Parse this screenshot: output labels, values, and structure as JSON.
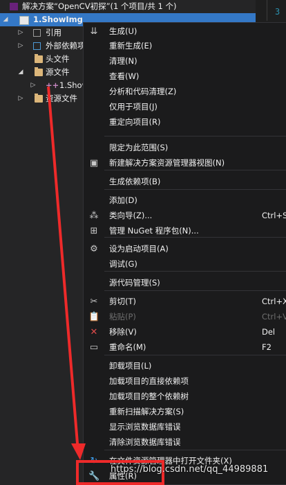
{
  "explorer": {
    "solution_label": "解决方案“OpenCV初探”(1 个项目/共 1 个)",
    "project_label": "1.ShowImg",
    "items": [
      {
        "label": "引用"
      },
      {
        "label": "外部依赖项"
      },
      {
        "label": "头文件"
      },
      {
        "label": "源文件"
      },
      {
        "label": "1.ShowImg"
      },
      {
        "label": "资源文件"
      }
    ]
  },
  "editor": {
    "line_number": "3"
  },
  "menu": {
    "items": [
      {
        "label": "生成(U)",
        "icon": "build-icon",
        "glyph": "⇊"
      },
      {
        "label": "重新生成(E)"
      },
      {
        "label": "清理(N)"
      },
      {
        "label": "查看(W)"
      },
      {
        "label": "分析和代码清理(Z)"
      },
      {
        "label": "仅用于项目(J)"
      },
      {
        "label": "重定向项目(R)"
      },
      {
        "label": "限定为此范围(S)"
      },
      {
        "label": "新建解决方案资源管理器视图(N)",
        "icon": "new-view-icon",
        "glyph": "▣"
      },
      {
        "label": "生成依赖项(B)"
      },
      {
        "label": "添加(D)"
      },
      {
        "label": "类向导(Z)...",
        "shortcut": "Ctrl+S",
        "icon": "class-wizard-icon",
        "glyph": "⁂"
      },
      {
        "label": "管理 NuGet 程序包(N)...",
        "icon": "nuget-icon",
        "glyph": "⊞"
      },
      {
        "label": "设为启动项目(A)",
        "icon": "gear-icon",
        "glyph": "⚙"
      },
      {
        "label": "调试(G)"
      },
      {
        "label": "源代码管理(S)"
      },
      {
        "label": "剪切(T)",
        "shortcut": "Ctrl+X",
        "icon": "scissors-icon",
        "glyph": "✂"
      },
      {
        "label": "粘贴(P)",
        "shortcut": "Ctrl+V",
        "icon": "paste-icon",
        "glyph": "📋",
        "disabled": true
      },
      {
        "label": "移除(V)",
        "shortcut": "Del",
        "icon": "remove-icon",
        "glyph": "✕"
      },
      {
        "label": "重命名(M)",
        "shortcut": "F2",
        "icon": "rename-icon",
        "glyph": "▭"
      },
      {
        "label": "卸载项目(L)"
      },
      {
        "label": "加载项目的直接依赖项"
      },
      {
        "label": "加载项目的整个依赖树"
      },
      {
        "label": "重新扫描解决方案(S)"
      },
      {
        "label": "显示浏览数据库错误"
      },
      {
        "label": "清除浏览数据库错误"
      },
      {
        "label": "在文件资源管理器中打开文件夹(X)",
        "icon": "open-folder-icon",
        "glyph": "↻"
      },
      {
        "label": "属性(R)",
        "icon": "wrench-icon",
        "glyph": "🔧"
      }
    ]
  },
  "watermark": "https://blog.csdn.net/qq_44989881",
  "colors": {
    "selected": "#3478c6",
    "menu_bg": "#1b1b1c",
    "annotation": "#ee2a2a",
    "remove_icon": "#e04b4b",
    "refresh_icon": "#3c9be8"
  }
}
